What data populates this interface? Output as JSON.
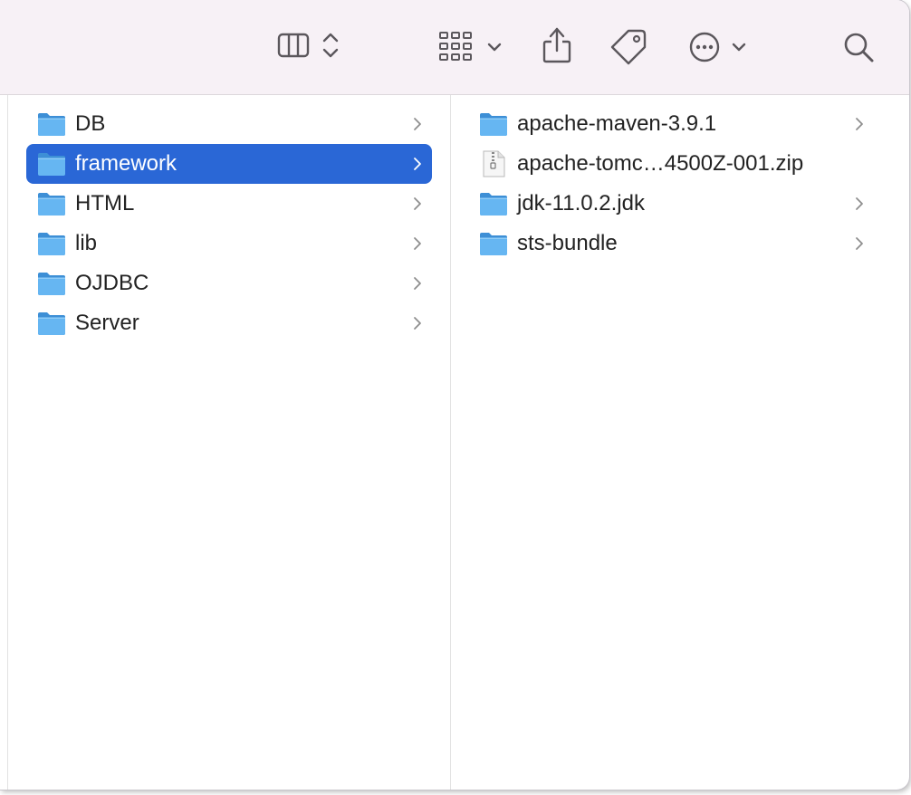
{
  "window": {
    "title": ""
  },
  "toolbar": {
    "view_button": "columns-view",
    "group_button": "group-by",
    "share_button": "share",
    "tag_button": "tags",
    "more_button": "more-actions",
    "search_button": "search"
  },
  "sidebar_column": {
    "items": [
      {
        "label": "DB",
        "type": "folder",
        "selected": false
      },
      {
        "label": "framework",
        "type": "folder",
        "selected": true
      },
      {
        "label": "HTML",
        "type": "folder",
        "selected": false
      },
      {
        "label": "lib",
        "type": "folder",
        "selected": false
      },
      {
        "label": "OJDBC",
        "type": "folder",
        "selected": false
      },
      {
        "label": "Server",
        "type": "folder",
        "selected": false
      }
    ]
  },
  "content_column": {
    "items": [
      {
        "label": "apache-maven-3.9.1",
        "type": "folder"
      },
      {
        "label": "apache-tomc…4500Z-001.zip",
        "type": "zip"
      },
      {
        "label": "jdk-11.0.2.jdk",
        "type": "folder"
      },
      {
        "label": "sts-bundle",
        "type": "folder"
      }
    ]
  },
  "colors": {
    "selection": "#2a67d6",
    "folder": "#5aaef0",
    "toolbar_bg": "#f7f1f6"
  }
}
